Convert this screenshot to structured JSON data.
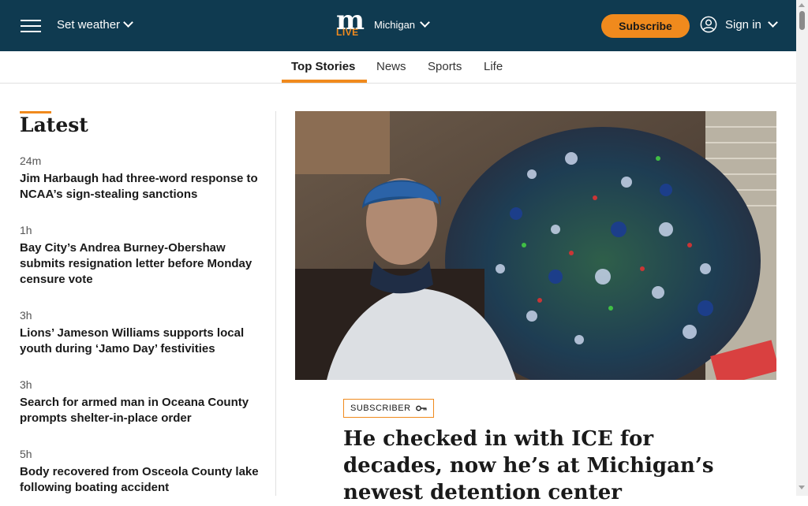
{
  "header": {
    "weather_label": "Set weather",
    "logo_letter": "m",
    "logo_sub": "LIVE",
    "region": "Michigan",
    "subscribe_label": "Subscribe",
    "signin_label": "Sign in",
    "brand_color": "#0f3a50",
    "accent_color": "#f08a1d"
  },
  "tabs": [
    {
      "label": "Top Stories",
      "active": true
    },
    {
      "label": "News"
    },
    {
      "label": "Sports"
    },
    {
      "label": "Life"
    }
  ],
  "latest": {
    "title": "Latest",
    "items": [
      {
        "time": "24m",
        "headline": "Jim Harbaugh had three-word response to NCAA’s sign-stealing sanctions"
      },
      {
        "time": "1h",
        "headline": "Bay City’s Andrea Burney-Obershaw submits resignation letter before Monday censure vote"
      },
      {
        "time": "3h",
        "headline": "Lions’ Jameson Williams supports local youth during ‘Jamo Day’ festivities"
      },
      {
        "time": "3h",
        "headline": "Search for armed man in Oceana County prompts shelter-in-place order"
      },
      {
        "time": "5h",
        "headline": "Body recovered from Osceola County lake following boating accident"
      }
    ]
  },
  "feature": {
    "badge": "SUBSCRIBER",
    "headline": "He checked in with ICE for decades, now he’s at Michigan’s newest detention center"
  }
}
